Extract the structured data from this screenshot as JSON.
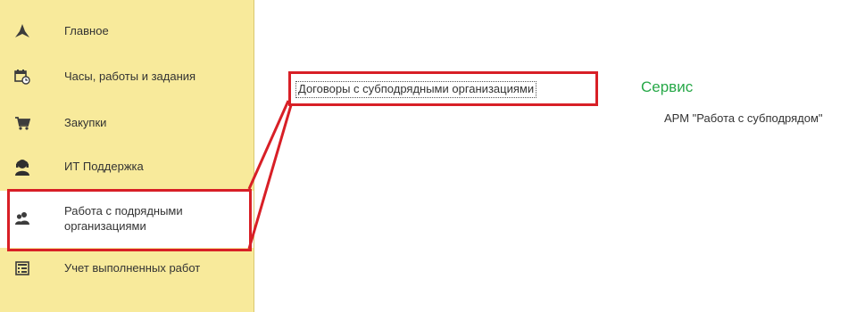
{
  "sidebar": {
    "items": [
      {
        "label": "Главное",
        "icon": "home-star-icon"
      },
      {
        "label": "Часы, работы и задания",
        "icon": "calendar-clock-icon"
      },
      {
        "label": "Закупки",
        "icon": "shopping-cart-icon"
      },
      {
        "label": "ИТ Поддержка",
        "icon": "support-person-icon"
      },
      {
        "label": "Работа с подрядными организациями",
        "icon": "people-icon",
        "selected": true
      },
      {
        "label": "Учет выполненных работ",
        "icon": "report-list-icon"
      }
    ]
  },
  "main": {
    "menu_link": "Договоры с субподрядными организациями",
    "section": {
      "title": "Сервис",
      "link": "АРМ \"Работа с субподрядом\""
    }
  },
  "colors": {
    "sidebar_bg": "#f8ea9b",
    "highlight": "#d81f26",
    "section_title": "#27a848"
  }
}
